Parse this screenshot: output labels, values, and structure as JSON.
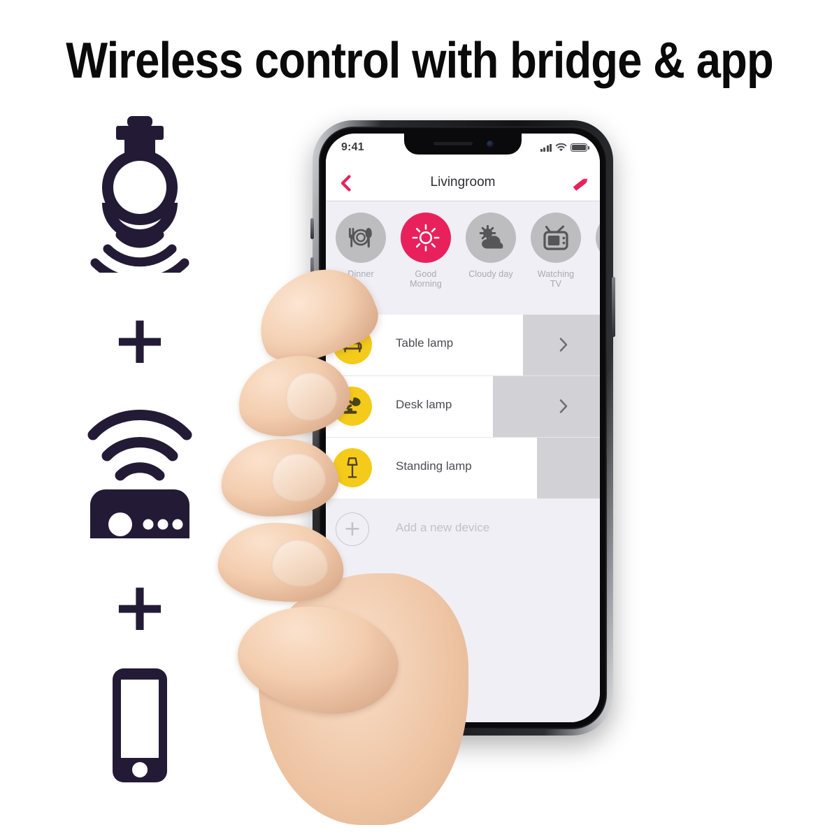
{
  "headline": "Wireless control with bridge & app",
  "colors": {
    "navy": "#231B36",
    "accent_pink": "#E8215C",
    "device_yellow": "#F5CB1B",
    "screen_bg": "#F0EFF5",
    "row_track": "#D2D2D6"
  },
  "left_column": [
    {
      "icon": "smart-bulb-icon",
      "label": ""
    },
    {
      "icon": "plus-sign",
      "label": "+"
    },
    {
      "icon": "bridge-icon",
      "label": ""
    },
    {
      "icon": "plus-sign",
      "label": "+"
    },
    {
      "icon": "smartphone-icon",
      "label": ""
    }
  ],
  "phone": {
    "status_bar": {
      "time": "9:41",
      "icons": [
        "signal-bars-icon",
        "wifi-icon",
        "battery-icon"
      ]
    },
    "nav_bar": {
      "back_icon": "chevron-left-icon",
      "title": "Livingroom",
      "edit_icon": "pencil-icon"
    },
    "scenes": [
      {
        "label": "Dinner",
        "icon": "cutlery-icon",
        "active": false
      },
      {
        "label": "Good\nMorning",
        "icon": "sun-icon",
        "active": true
      },
      {
        "label": "Cloudy day",
        "icon": "sun-cloud-icon",
        "active": false
      },
      {
        "label": "Watching\nTV",
        "icon": "television-icon",
        "active": false
      },
      {
        "label": "",
        "icon": "partial-icon",
        "active": false
      }
    ],
    "devices": [
      {
        "name": "Table lamp",
        "icon": "armchair-icon",
        "brightness_pct": 72,
        "chevron": "›"
      },
      {
        "name": "Desk lamp",
        "icon": "desk-lamp-icon",
        "brightness_pct": 61,
        "chevron": "›"
      },
      {
        "name": "Standing lamp",
        "icon": "floor-lamp-icon",
        "brightness_pct": 77,
        "chevron": ""
      }
    ],
    "add_device": {
      "label": "Add a new device",
      "icon": "plus-circle-icon",
      "plus": "+"
    }
  }
}
